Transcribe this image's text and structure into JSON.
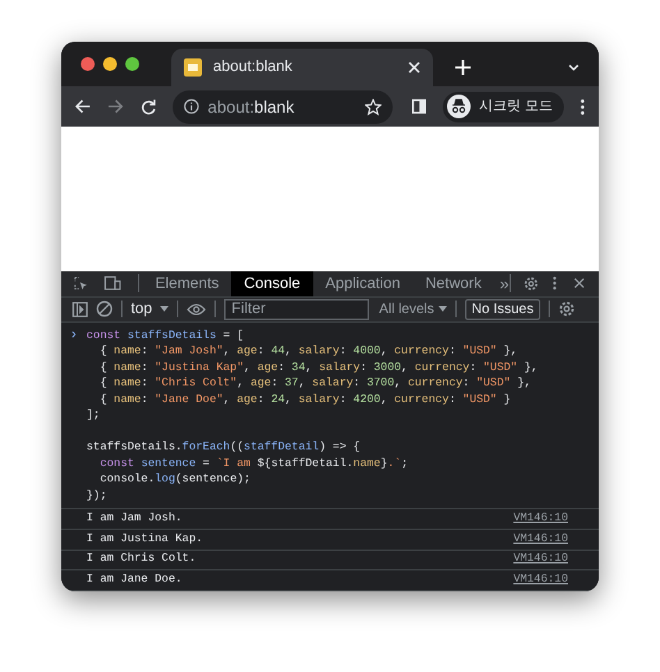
{
  "browser": {
    "tab": {
      "title": "about:blank"
    },
    "address": {
      "host_prefix": "about:",
      "host": "blank"
    },
    "profile": {
      "label": "시크릿 모드"
    }
  },
  "devtools": {
    "tabs": [
      {
        "label": "Elements",
        "selected": false
      },
      {
        "label": "Console",
        "selected": true
      },
      {
        "label": "Application",
        "selected": false
      },
      {
        "label": "Network",
        "selected": false
      }
    ],
    "overflow": "»",
    "context": "top",
    "filter": {
      "placeholder": "Filter"
    },
    "levels": "All levels",
    "issues": "No Issues"
  },
  "console": {
    "prompt": "›",
    "code_blocks": [
      [
        [
          {
            "kind": "kw",
            "text": "const"
          },
          {
            "kind": "var",
            "text": " staffsDetails"
          },
          {
            "kind": "punct",
            "text": " = ["
          }
        ],
        [
          {
            "kind": "punct",
            "text": "  { "
          },
          {
            "kind": "prop",
            "text": "name"
          },
          {
            "kind": "punct",
            "text": ": "
          },
          {
            "kind": "str",
            "text": "\"Jam Josh\""
          },
          {
            "kind": "punct",
            "text": ", "
          },
          {
            "kind": "prop",
            "text": "age"
          },
          {
            "kind": "punct",
            "text": ": "
          },
          {
            "kind": "num",
            "text": "44"
          },
          {
            "kind": "punct",
            "text": ", "
          },
          {
            "kind": "prop",
            "text": "salary"
          },
          {
            "kind": "punct",
            "text": ": "
          },
          {
            "kind": "num",
            "text": "4000"
          },
          {
            "kind": "punct",
            "text": ", "
          },
          {
            "kind": "prop",
            "text": "currency"
          },
          {
            "kind": "punct",
            "text": ": "
          },
          {
            "kind": "str",
            "text": "\"USD\""
          },
          {
            "kind": "punct",
            "text": " },"
          }
        ],
        [
          {
            "kind": "punct",
            "text": "  { "
          },
          {
            "kind": "prop",
            "text": "name"
          },
          {
            "kind": "punct",
            "text": ": "
          },
          {
            "kind": "str",
            "text": "\"Justina Kap\""
          },
          {
            "kind": "punct",
            "text": ", "
          },
          {
            "kind": "prop",
            "text": "age"
          },
          {
            "kind": "punct",
            "text": ": "
          },
          {
            "kind": "num",
            "text": "34"
          },
          {
            "kind": "punct",
            "text": ", "
          },
          {
            "kind": "prop",
            "text": "salary"
          },
          {
            "kind": "punct",
            "text": ": "
          },
          {
            "kind": "num",
            "text": "3000"
          },
          {
            "kind": "punct",
            "text": ", "
          },
          {
            "kind": "prop",
            "text": "currency"
          },
          {
            "kind": "punct",
            "text": ": "
          },
          {
            "kind": "str",
            "text": "\"USD\""
          },
          {
            "kind": "punct",
            "text": " },"
          }
        ],
        [
          {
            "kind": "punct",
            "text": "  { "
          },
          {
            "kind": "prop",
            "text": "name"
          },
          {
            "kind": "punct",
            "text": ": "
          },
          {
            "kind": "str",
            "text": "\"Chris Colt\""
          },
          {
            "kind": "punct",
            "text": ", "
          },
          {
            "kind": "prop",
            "text": "age"
          },
          {
            "kind": "punct",
            "text": ": "
          },
          {
            "kind": "num",
            "text": "37"
          },
          {
            "kind": "punct",
            "text": ", "
          },
          {
            "kind": "prop",
            "text": "salary"
          },
          {
            "kind": "punct",
            "text": ": "
          },
          {
            "kind": "num",
            "text": "3700"
          },
          {
            "kind": "punct",
            "text": ", "
          },
          {
            "kind": "prop",
            "text": "currency"
          },
          {
            "kind": "punct",
            "text": ": "
          },
          {
            "kind": "str",
            "text": "\"USD\""
          },
          {
            "kind": "punct",
            "text": " },"
          }
        ],
        [
          {
            "kind": "punct",
            "text": "  { "
          },
          {
            "kind": "prop",
            "text": "name"
          },
          {
            "kind": "punct",
            "text": ": "
          },
          {
            "kind": "str",
            "text": "\"Jane Doe\""
          },
          {
            "kind": "punct",
            "text": ", "
          },
          {
            "kind": "prop",
            "text": "age"
          },
          {
            "kind": "punct",
            "text": ": "
          },
          {
            "kind": "num",
            "text": "24"
          },
          {
            "kind": "punct",
            "text": ", "
          },
          {
            "kind": "prop",
            "text": "salary"
          },
          {
            "kind": "punct",
            "text": ": "
          },
          {
            "kind": "num",
            "text": "4200"
          },
          {
            "kind": "punct",
            "text": ", "
          },
          {
            "kind": "prop",
            "text": "currency"
          },
          {
            "kind": "punct",
            "text": ": "
          },
          {
            "kind": "str",
            "text": "\"USD\""
          },
          {
            "kind": "punct",
            "text": " }"
          }
        ],
        [
          {
            "kind": "punct",
            "text": "];"
          }
        ]
      ],
      [
        [
          {
            "kind": "punct",
            "text": "staffsDetails."
          },
          {
            "kind": "fn",
            "text": "forEach"
          },
          {
            "kind": "punct",
            "text": "(("
          },
          {
            "kind": "var",
            "text": "staffDetail"
          },
          {
            "kind": "punct",
            "text": ") => {"
          }
        ],
        [
          {
            "kind": "kw",
            "text": "  const"
          },
          {
            "kind": "var",
            "text": " sentence"
          },
          {
            "kind": "punct",
            "text": " = "
          },
          {
            "kind": "str",
            "text": "`I am "
          },
          {
            "kind": "punct",
            "text": "${staffDetail."
          },
          {
            "kind": "prop",
            "text": "name"
          },
          {
            "kind": "punct",
            "text": "}"
          },
          {
            "kind": "str",
            "text": ".`"
          },
          {
            "kind": "punct",
            "text": ";"
          }
        ],
        [
          {
            "kind": "punct",
            "text": "  console."
          },
          {
            "kind": "fn",
            "text": "log"
          },
          {
            "kind": "punct",
            "text": "(sentence);"
          }
        ],
        [
          {
            "kind": "punct",
            "text": "});"
          }
        ]
      ]
    ],
    "logs": [
      {
        "text": "I am Jam Josh.",
        "source": "VM146:10"
      },
      {
        "text": "I am Justina Kap.",
        "source": "VM146:10"
      },
      {
        "text": "I am Chris Colt.",
        "source": "VM146:10"
      },
      {
        "text": "I am Jane Doe.",
        "source": "VM146:10"
      }
    ]
  }
}
